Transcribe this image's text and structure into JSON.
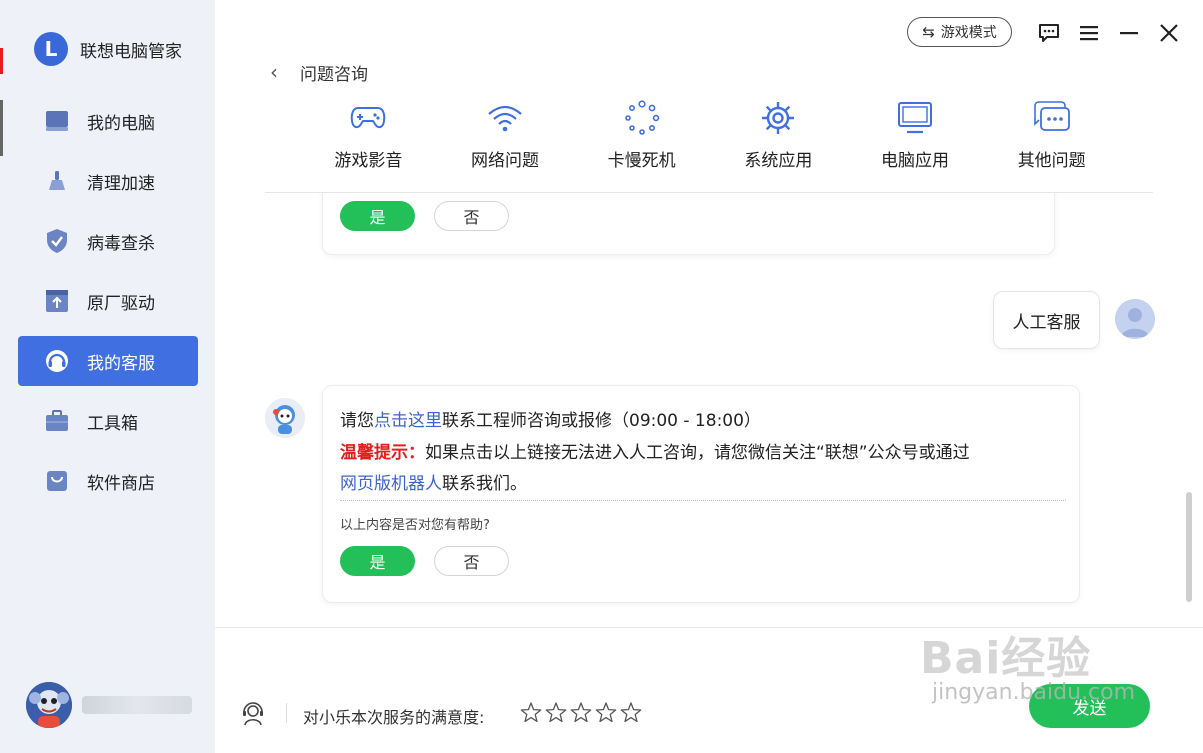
{
  "app": {
    "name": "联想电脑管家",
    "logo_letter": "L"
  },
  "sidebar": {
    "items": [
      {
        "label": "我的电脑",
        "icon": "computer-icon",
        "active": false
      },
      {
        "label": "清理加速",
        "icon": "broom-icon",
        "active": false
      },
      {
        "label": "病毒查杀",
        "icon": "shield-icon",
        "active": false
      },
      {
        "label": "原厂驱动",
        "icon": "driver-upload-icon",
        "active": false
      },
      {
        "label": "我的客服",
        "icon": "customer-service-icon",
        "active": true
      },
      {
        "label": "工具箱",
        "icon": "toolbox-icon",
        "active": false
      },
      {
        "label": "软件商店",
        "icon": "store-bag-icon",
        "active": false
      }
    ]
  },
  "topbar": {
    "game_mode_label": "游戏模式"
  },
  "header": {
    "title": "问题咨询",
    "categories": [
      {
        "label": "游戏影音",
        "icon": "gamepad-icon"
      },
      {
        "label": "网络问题",
        "icon": "wifi-icon"
      },
      {
        "label": "卡慢死机",
        "icon": "loading-spinner-icon"
      },
      {
        "label": "系统应用",
        "icon": "gear-icon"
      },
      {
        "label": "电脑应用",
        "icon": "monitor-icon"
      },
      {
        "label": "其他问题",
        "icon": "chat-bubbles-icon"
      }
    ]
  },
  "chat": {
    "feedback_yes": "是",
    "feedback_no": "否",
    "user_message": "人工客服",
    "bot_reply": {
      "line1_prefix": "请您",
      "line1_link": "点击这里",
      "line1_suffix": "联系工程师咨询或报修（09:00 - 18:00）",
      "tip_label": "温馨提示：",
      "tip_text": "如果点击以上链接无法进入人工咨询，请您微信关注“联想”公众号或通过",
      "line3_link": "网页版机器人",
      "line3_suffix": "联系我们。",
      "helpful_question": "以上内容是否对您有帮助?"
    }
  },
  "footer": {
    "satisfaction_label": "对小乐本次服务的满意度:",
    "stars": 5,
    "send_label": "发送"
  },
  "watermark": {
    "brand": "Bai经验",
    "site": "jingyan.baidu.com"
  },
  "colors": {
    "accent": "#3f6fe0",
    "green": "#23c05a",
    "warn": "#e0201e",
    "link": "#3d64c9"
  }
}
